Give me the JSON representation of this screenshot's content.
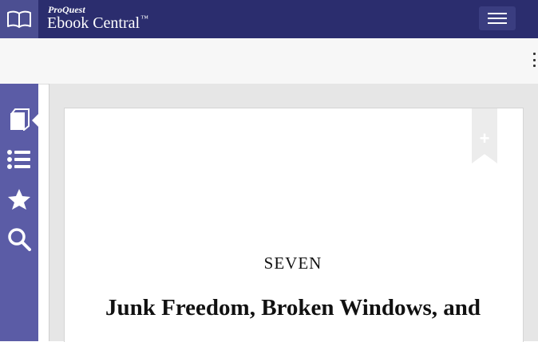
{
  "header": {
    "brand_top": "ProQuest",
    "brand_main": "Ebook Central",
    "trademark": "™",
    "logo_icon": "open-book-icon",
    "menu_icon": "hamburger-menu-icon"
  },
  "toolbar": {
    "more_icon": "vertical-dots-icon"
  },
  "sidebar": {
    "items": [
      {
        "icon": "book-icon",
        "active": true
      },
      {
        "icon": "list-icon"
      },
      {
        "icon": "star-icon"
      },
      {
        "icon": "search-icon"
      }
    ]
  },
  "page": {
    "chapter_number": "SEVEN",
    "chapter_title": "Junk Freedom, Broken Windows, and",
    "bookmark_icon": "add-bookmark-icon",
    "bookmark_glyph": "+"
  },
  "colors": {
    "topbar": "#2b2d6e",
    "sidebar": "#5b5ca6",
    "logo_box": "#4c4f92"
  }
}
